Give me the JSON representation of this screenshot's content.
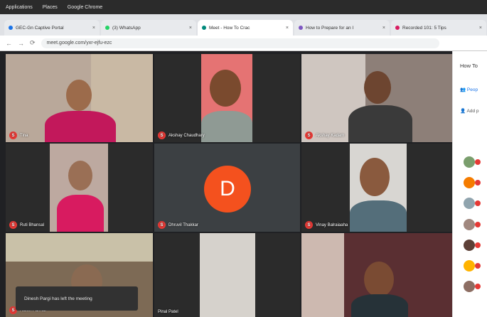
{
  "os_bar": {
    "items": [
      "Applications",
      "Places",
      "Google Chrome"
    ]
  },
  "browser": {
    "tabs": [
      {
        "label": "GEC-Gn Captive Portal",
        "color": "#1a73e8",
        "active": false
      },
      {
        "label": "(3) WhatsApp",
        "color": "#25d366",
        "active": false
      },
      {
        "label": "Meet - How To Crac",
        "color": "#00897b",
        "active": true
      },
      {
        "label": "How to Prepare for an I",
        "color": "#7e57c2",
        "active": false
      },
      {
        "label": "Recorded 101: 5 Tips",
        "color": "#d81b60",
        "active": false
      }
    ],
    "url": "meet.google.com/yxr-ejfu-ezc"
  },
  "meet": {
    "participants": [
      {
        "name": "Tina",
        "badge": "S"
      },
      {
        "name": "Akshay Chaudhary",
        "badge": "S"
      },
      {
        "name": "Akshay Kadam",
        "badge": "S"
      },
      {
        "name": "Ruti Bhansal",
        "badge": "S"
      },
      {
        "name": "Dhruvil Thakkar",
        "badge": "S",
        "avatar_letter": "D"
      },
      {
        "name": "Vinay Balraiaaha",
        "badge": "S"
      },
      {
        "name": "Harsh Parmar",
        "badge": "S"
      },
      {
        "name": "Pinal Patel",
        "badge": ""
      },
      {
        "name": "",
        "badge": ""
      }
    ],
    "toast": "Dinesh Pargi has left the meeting"
  },
  "side_panel": {
    "title": "How To",
    "tab_people": "Peop",
    "tab_add": "Add p",
    "avatar_colors": [
      "#7a9e6d",
      "#f57c00",
      "#90a4ae",
      "#a1887f",
      "#5d4037",
      "#ffb300",
      "#8d6e63"
    ]
  }
}
